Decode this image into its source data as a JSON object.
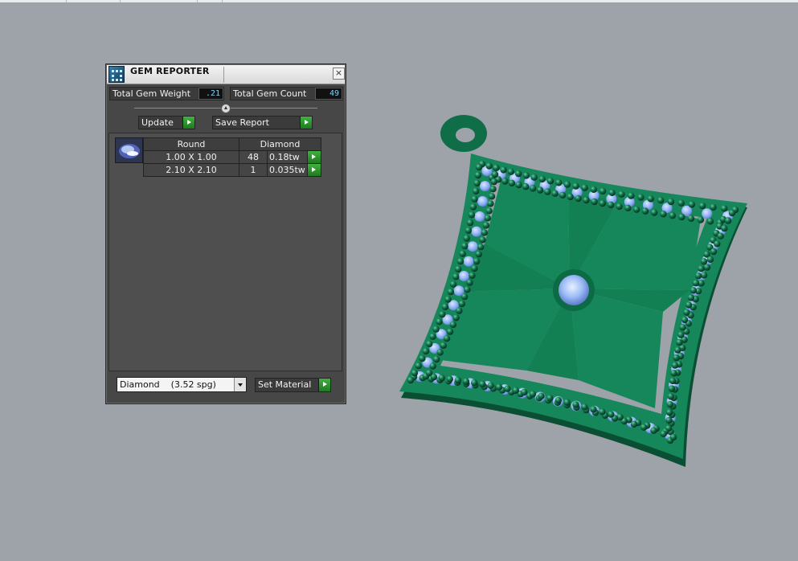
{
  "window": {
    "title": "GEM REPORTER",
    "close_glyph": "×"
  },
  "stats": {
    "total_weight_label": "Total Gem Weight",
    "total_weight_value": ".21",
    "total_count_label": "Total Gem Count",
    "total_count_value": "49"
  },
  "buttons": {
    "update": "Update",
    "save_report": "Save Report",
    "set_material": "Set Material"
  },
  "table": {
    "headers": [
      "Round",
      "Diamond"
    ],
    "rows": [
      {
        "size": "1.00 X 1.00",
        "count": "48",
        "weight": "0.18tw"
      },
      {
        "size": "2.10 X 2.10",
        "count": "1",
        "weight": "0.035tw"
      }
    ]
  },
  "material": {
    "selected": "Diamond    (3.52 spg)"
  },
  "icons": [
    "app-icon",
    "close-icon",
    "slider-thumb-icon",
    "go-arrow-icon",
    "dropdown-arrow-icon",
    "round-gem-icon"
  ],
  "colors": {
    "panel": "#474747",
    "viewport": "#9da3a9",
    "metal": "#13845a",
    "gem": "#8fb4ff",
    "accent_green": "#2e9a2e"
  }
}
